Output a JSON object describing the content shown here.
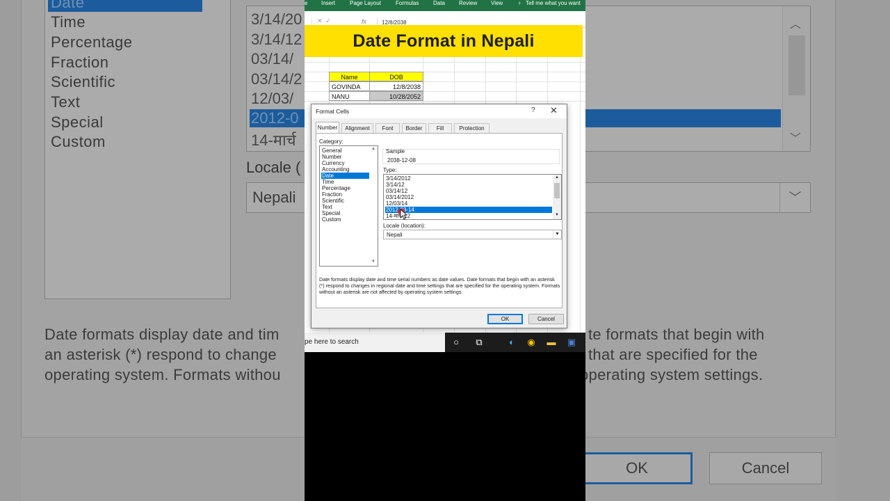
{
  "video_title": "Date Format in Nepali",
  "ribbon": {
    "tabs": [
      "e",
      "Insert",
      "Page Layout",
      "Formulas",
      "Data",
      "Review",
      "View"
    ],
    "tell_me": "Tell me what you want"
  },
  "formula_bar": {
    "fx": "fx",
    "value": "12/8/2038"
  },
  "sheet": {
    "headers": [
      "Name",
      "DOB"
    ],
    "rows": [
      [
        "GOVINDA",
        "12/8/2038"
      ],
      [
        "NANU",
        "10/28/2052"
      ]
    ]
  },
  "dialog": {
    "title": "Format Cells",
    "help": "?",
    "close": "✕",
    "tabs": [
      "Number",
      "Alignment",
      "Font",
      "Border",
      "Fill",
      "Protection"
    ],
    "category_label": "Category:",
    "categories": [
      "General",
      "Number",
      "Currency",
      "Accounting",
      "Date",
      "Time",
      "Percentage",
      "Fraction",
      "Scientific",
      "Text",
      "Special",
      "Custom"
    ],
    "selected_category": "Date",
    "sample_label": "Sample",
    "sample_value": "2038-12-08",
    "type_label": "Type:",
    "types": [
      "3/14/2012",
      "3/14/12",
      "03/14/12",
      "03/14/2012",
      "12/03/14",
      "2012-03-14",
      "14-मार्च-12"
    ],
    "selected_type_index": 5,
    "locale_label": "Locale (location):",
    "locale_value": "Nepali",
    "description": "Date formats display date and time serial numbers as date values.  Date formats that begin with an asterisk (*) respond to changes in regional date and time settings that are specified for the operating system. Formats without an asterisk are not affected by operating system settings.",
    "ok_label": "OK",
    "cancel_label": "Cancel"
  },
  "taskbar": {
    "search_text": "pe here to search"
  },
  "background": {
    "categories": [
      "Date",
      "Time",
      "Percentage",
      "Fraction",
      "Scientific",
      "Text",
      "Special",
      "Custom"
    ],
    "types": [
      "3/14/20",
      "3/14/12",
      "03/14/",
      "03/14/2",
      "12/03/",
      "2012-0",
      "14-मार्च"
    ],
    "locale_label": "Locale (",
    "locale_value": "Nepali",
    "desc_left": [
      "Date formats display date and tim",
      "an asterisk (*) respond to change",
      "operating system. Formats withou"
    ],
    "desc_right": [
      "te formats that begin with",
      "that are specified for the",
      "operating system settings."
    ],
    "ok_label": "OK",
    "cancel_label": "Cancel"
  },
  "colors": {
    "excel_green": "#217346",
    "banner_yellow": "#ffe000",
    "header_yellow": "#ffff00",
    "selection_blue": "#0078d7"
  }
}
